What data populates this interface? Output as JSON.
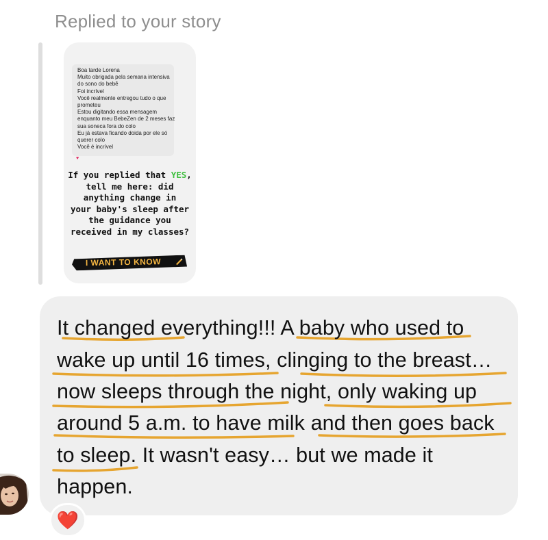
{
  "header": {
    "reply_label": "Replied to your story"
  },
  "story": {
    "inner_message_lines": [
      "Boa tarde Lorena",
      "Muito obrigada pela semana intensiva",
      "do sono do bebê",
      "Foi incrível",
      "Você realmente entregou tudo o que",
      "prometeu",
      "Estou digitando essa mensagem",
      "enquanto meu BebeZen de 2 meses faz",
      "sua soneca fora do colo",
      "Eu já estava ficando doida por ele só",
      "querer colo",
      "Você é incrível"
    ],
    "inner_heart": "♥",
    "cta_lines": [
      {
        "pre": "If you replied that ",
        "highlight": "YES",
        "post": ","
      },
      {
        "pre": "tell me here: did",
        "highlight": "",
        "post": ""
      },
      {
        "pre": "anything change in",
        "highlight": "",
        "post": ""
      },
      {
        "pre": "your baby's sleep after",
        "highlight": "",
        "post": ""
      },
      {
        "pre": "the guidance you",
        "highlight": "",
        "post": ""
      },
      {
        "pre": "received in my classes?",
        "highlight": "",
        "post": ""
      }
    ],
    "button_label": "I WANT TO KNOW",
    "yes_color": "#3fbf3f",
    "button_text_color": "#f5b642"
  },
  "message": {
    "lines": [
      "It changed everything!!! A baby who used to",
      "wake up until 16 times, clinging to the breast…",
      "now sleeps through the night, only waking up",
      "around 5 a.m. to have milk and then goes back",
      "to sleep.  It wasn't easy… but we made it",
      "happen."
    ],
    "underline_color": "#e6a530"
  },
  "reaction": {
    "emoji": "❤️"
  },
  "avatar": {
    "icon": "user-avatar"
  }
}
